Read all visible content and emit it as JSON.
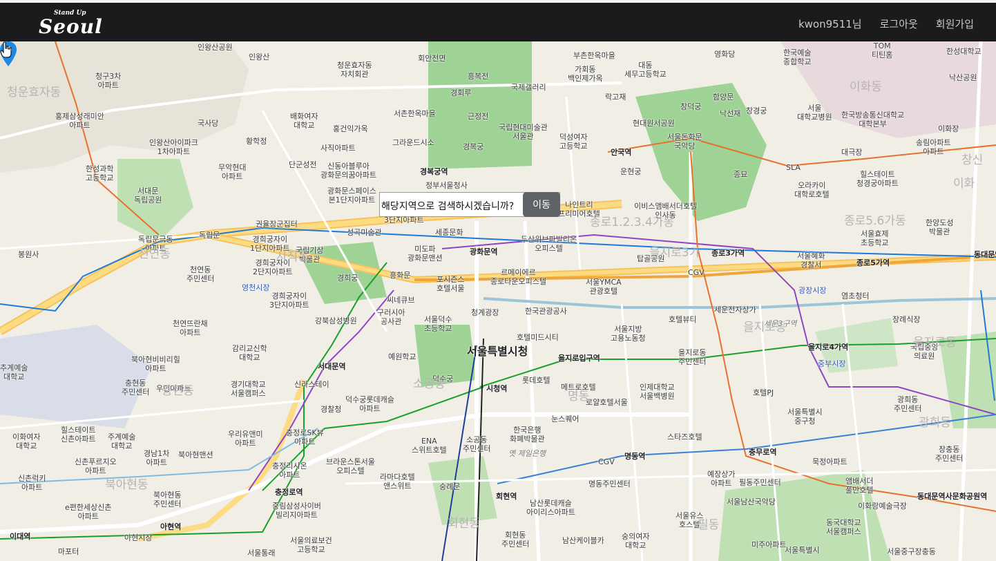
{
  "header": {
    "logo_top": "Stand Up",
    "logo_main": "Seoul",
    "nav": {
      "user": "kwon9511님",
      "logout": "로그아웃",
      "signup": "회원가입"
    }
  },
  "dialog": {
    "question": "해당지역으로 검색하시겠습니까?",
    "move_button": "이동"
  },
  "map": {
    "labels": {
      "l0": "인왕산공원",
      "l1": "인왕산",
      "l2": "청운효자동\n자치회관",
      "l3": "회안전면",
      "l4": "흥복전",
      "l5": "부촌한옥마을",
      "l6": "가회동\n백인제가옥",
      "l7": "대동\n세무고등학교",
      "l8": "영화당",
      "l9": "한국예술\n종합학교",
      "l10": "TOM\n티틴홈",
      "l11": "한성대학교",
      "l12": "청구3차\n아파트",
      "l13": "홍제삼성래미안\n아파트",
      "l14": "국사당",
      "l15": "배화여자\n대학교",
      "l16": "홍건익가옥",
      "l17": "서촌한옥마을",
      "l18": "경회루",
      "l19": "근정전",
      "l20": "국제갤러리",
      "l21": "락고재",
      "l22": "창덕궁",
      "l23": "함양문",
      "l24": "낙선재",
      "l25": "창경궁",
      "l26": "서울\n대학교병원",
      "l27": "한국방송통신대학교\n대학본부",
      "l28": "이화장",
      "l29": "낙산공원",
      "l30": "인왕산아이파크\n1차아파트",
      "l31": "황학정",
      "l32": "사직아파트",
      "l33": "그라운드시소",
      "l34": "국립현대미술관\n서울관",
      "l35": "경복궁",
      "l36": "덕성여자\n고등학교",
      "l37": "현대원서공원",
      "l38": "서울돈화문\n국악당",
      "l39": "대극장",
      "l40": "송림아파트\n아파트",
      "l41": "한성과학\n고등학교",
      "l42": "무악현대\n아파트",
      "l43": "단군성전",
      "l44": "신동아블루아\n광화문의꿈아파트",
      "l45": "경복궁역",
      "l46": "안국역",
      "l47": "운현궁",
      "l48": "종묘",
      "l49": "SLA",
      "l50": "힐스테이트\n청경궁아파트",
      "l51": "서대문\n독립공원",
      "l52": "광화문스페이스\n본1단지아파트",
      "l53": "정부서울청사",
      "l54": "나인트리\n프리미어호텔",
      "l55": "이비스앰배서더호텔\n인사동",
      "l56": "오라카이\n대학로호텔",
      "l57": "창신",
      "l58": "독립문",
      "l59": "권율장군집터",
      "l60": "3단지아파트",
      "l61": "성곡미술관",
      "l62": "세종문화",
      "l63": "종로1.2.3.4가동",
      "l64": "종로5.6가동",
      "l65": "서울효제\n초등학교",
      "l66": "한양도성\n박물관",
      "l67": "독립문극동\n아파트",
      "l68": "봉원사",
      "l69": "경희궁자이\n1단지아파트",
      "l70": "국립기상\n박물관",
      "l71": "미도파\n광화문맨션",
      "l72": "광화문역",
      "l73": "두산위브파빌리온\n오피스텔",
      "l74": "탑골공원",
      "l75": "종로3가역",
      "l76": "서울혜화\n경찰서",
      "l77": "종로5가역",
      "l78": "동대문역",
      "l79": "천연동\n주민센터",
      "l80": "경희궁자이\n2단지아파트",
      "l81": "경희궁",
      "l82": "흥화문",
      "l83": "포시즌스\n호텔서울",
      "l84": "르메이에르\n종로타운오피스텔",
      "l85": "서울YMCA\n관광호텔",
      "l86": "CGV",
      "l87": "광장시장",
      "l88": "영천시장",
      "l89": "경희궁자이\n3단지아파트",
      "l90": "씨네큐브",
      "l91": "청계광장",
      "l92": "한국관광공사",
      "l93": "세운전자상가",
      "l94": "염초청터",
      "l95": "천연뜨란채\n아파트",
      "l96": "강북삼성병원",
      "l97": "구러시아\n공사관",
      "l98": "서울덕수\n초등학교",
      "l99": "호텔미드시티",
      "l100": "서울지방\n고용노동청",
      "l101": "호텔뷰티",
      "l102": "을지로동",
      "l103": "장례식장",
      "l104": "감리교신학\n대학교",
      "l105": "서대문역",
      "l106": "예원학교",
      "l107": "서울특별시청",
      "l108": "을지로입구역",
      "l109": "을지로동\n주민센터",
      "l110": "을지로4가역",
      "l111": "국립중앙\n의료원",
      "l112": "북아현비비리힐\n아파트",
      "l113": "중부시장",
      "l114": "덕수궁",
      "l115": "추계예술\n대학교",
      "l116": "충현동\n주민센터",
      "l117": "우민아파트",
      "l118": "경기대학교\n서울캠퍼스",
      "l119": "신라스테이",
      "l120": "시청역",
      "l121": "롯데호텔",
      "l122": "메트로호텔",
      "l123": "인제대학교\n서울백병원",
      "l124": "호텔PJ",
      "l125": "서울특별시\n중구청",
      "l126": "광희동\n주민센터",
      "l127": "덕수궁롯데캐슬\n아파트",
      "l128": "힐스테이트\n신촌아파트",
      "l129": "이화여자\n대학교",
      "l130": "주계예술\n대학교",
      "l131": "우리유앤미\n아파트",
      "l132": "충정로SK뷰\n아파트",
      "l133": "경찰청",
      "l134": "로얄호텔서울",
      "l135": "눈스퀘어",
      "l136": "한국은행\n화폐박물관",
      "l137": "스타즈호텔",
      "l138": "ENA\n스위트호텔",
      "l139": "소공동\n주민센터",
      "l140": "신촌푸르지오\n아파트",
      "l141": "경남1차\n아파트",
      "l142": "북아현맨션",
      "l143": "충정리시온\n아파트",
      "l144": "브라운스톤서울\n오피스텔",
      "l145": "라마다호텔\n앤스위트",
      "l146": "CGV",
      "l147": "명동역",
      "l148": "충무로역",
      "l149": "예장상가\n아파트",
      "l150": "묵정아파트",
      "l151": "앰배서더\n풀만호텔",
      "l152": "장충동\n주민센터",
      "l153": "신촌럭키\n아파트",
      "l154": "북아현동\n주민센터",
      "l155": "충정로역",
      "l156": "숭례문",
      "l157": "명동주민센터",
      "l158": "필동주민센터",
      "l159": "서울남산국악당",
      "l160": "동대문역사문화공원역",
      "l161": "e편한세상신촌\n아파트",
      "l162": "중림삼성사이버\n빌리지아파트",
      "l163": "남산롯데캐슬\n아이리스아파트",
      "l164": "회현역",
      "l165": "서울유스\n호스텔",
      "l166": "이화랑예술극장",
      "l167": "동국대학교\n서울캠퍼스",
      "l168": "이대역",
      "l169": "아현역",
      "l170": "아현시장",
      "l171": "서울의료보건\n고등학교",
      "l172": "회현동\n주민센터",
      "l173": "남산케이블카",
      "l174": "숭의여자\n대학교",
      "l175": "미주아파트",
      "l176": "마포터",
      "l177": "서울통래",
      "l178": "서울특별시",
      "l179": "서울중구장충동",
      "l180": "청운효자동",
      "l181": "사직동",
      "l182": "천연동",
      "l183": "충현동",
      "l184": "북아현동",
      "l185": "소공동",
      "l186": "명동",
      "l187": "필동",
      "l188": "회현동",
      "l189": "광희동",
      "l190": "이화동",
      "l191": "을지로동",
      "l192": "세운3구역",
      "l193": "옛 제일은행",
      "l194": "을지로3가",
      "l195": "이화"
    }
  }
}
